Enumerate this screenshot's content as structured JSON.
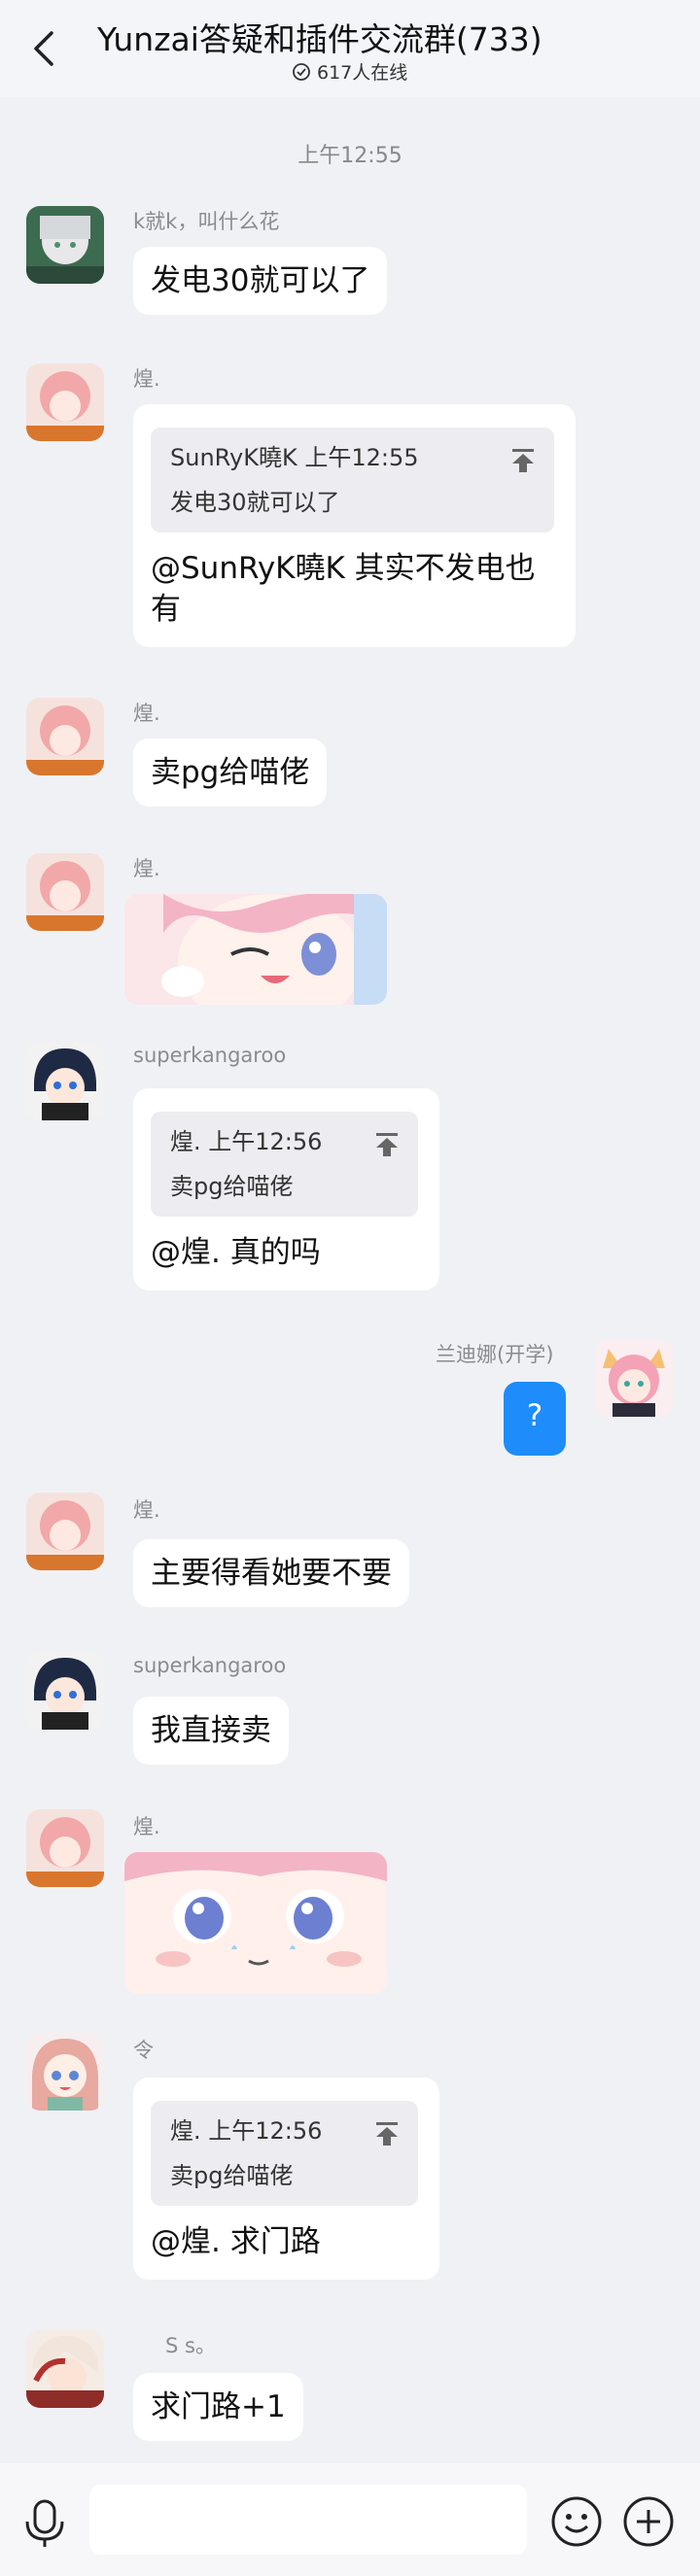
{
  "header": {
    "title": "Yunzai答疑和插件交流群(733)",
    "online": "617人在线"
  },
  "timestamp": "上午12:55",
  "messages": [
    {
      "sender": "k就k，叫什么花",
      "text": "发电30就可以了"
    },
    {
      "sender": "煌.",
      "quote_head": "SunRyK曉K 上午12:55",
      "quote_text": "发电30就可以了",
      "text_line1": "@SunRyK曉K 其实不发电也",
      "text_line2": "有"
    },
    {
      "sender": "煌.",
      "text": "卖pg给喵佬"
    },
    {
      "sender": "煌.",
      "sticker": "wink-anime-girl-sticker"
    },
    {
      "sender": "superkangaroo",
      "quote_head": "煌. 上午12:56",
      "quote_text": "卖pg给喵佬",
      "text": "@煌. 真的吗"
    },
    {
      "sender": "兰迪娜(开学)",
      "text": "?",
      "mine": true
    },
    {
      "sender": "煌.",
      "text": "主要得看她要不要"
    },
    {
      "sender": "superkangaroo",
      "text": "我直接卖"
    },
    {
      "sender": "煌.",
      "sticker": "sweating-anime-girl-sticker"
    },
    {
      "sender": "令",
      "quote_head": "煌. 上午12:56",
      "quote_text": "卖pg给喵佬",
      "text": "@煌. 求门路"
    },
    {
      "sender": "S s。",
      "text": "求门路+1"
    }
  ],
  "colors": {
    "background": "#f0f1f5",
    "bubble": "#ffffff",
    "my_bubble": "#1e8cfa",
    "quote": "#edecf0"
  },
  "icons": {
    "back": "chevron-left-icon",
    "online": "check-circle-icon",
    "voice": "microphone-icon",
    "emoji": "smiley-icon",
    "plus": "plus-circle-icon",
    "quote_jump": "jump-to-top-icon"
  }
}
